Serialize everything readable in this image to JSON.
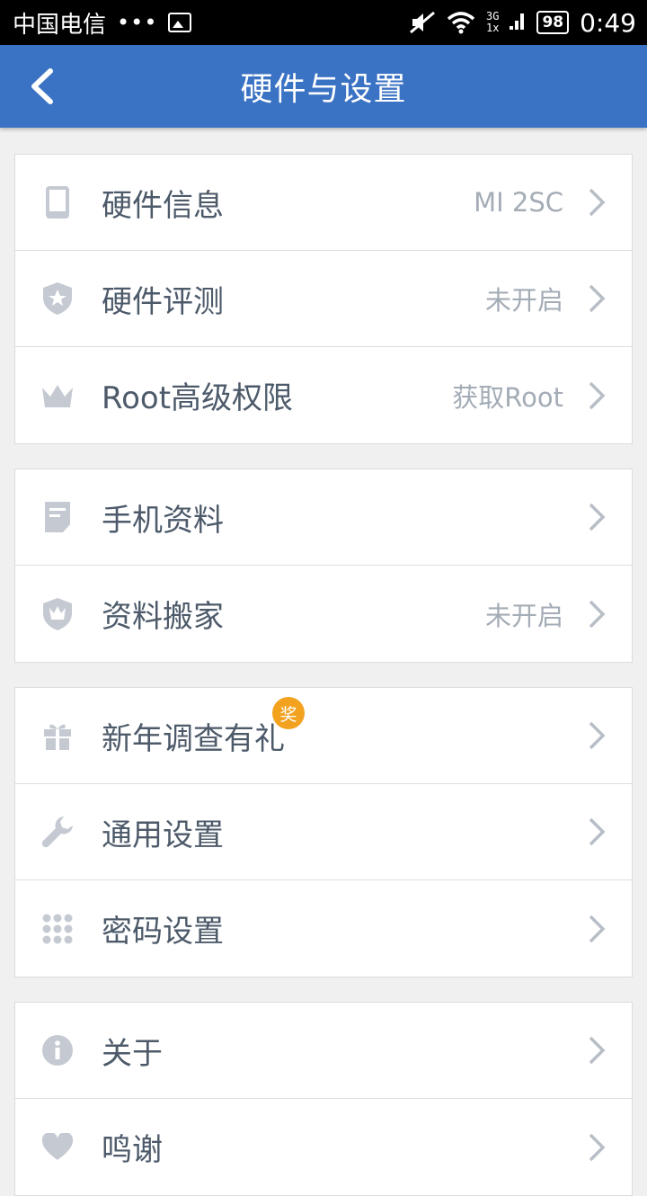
{
  "status_bar": {
    "carrier": "中国电信",
    "dots": "•••",
    "network_top": "3G",
    "network_bottom": "1x",
    "battery": "98",
    "time": "0:49"
  },
  "header": {
    "title": "硬件与设置"
  },
  "groups": [
    {
      "items": [
        {
          "icon": "phone-icon",
          "label": "硬件信息",
          "value": "MI 2SC"
        },
        {
          "icon": "shield-star-icon",
          "label": "硬件评测",
          "value": "未开启"
        },
        {
          "icon": "crown-icon",
          "label": "Root高级权限",
          "value": "获取Root"
        }
      ]
    },
    {
      "items": [
        {
          "icon": "document-icon",
          "label": "手机资料",
          "value": ""
        },
        {
          "icon": "shield-crown-icon",
          "label": "资料搬家",
          "value": "未开启"
        }
      ]
    },
    {
      "items": [
        {
          "icon": "gift-icon",
          "label": "新年调查有礼",
          "value": "",
          "badge": "奖"
        },
        {
          "icon": "wrench-icon",
          "label": "通用设置",
          "value": ""
        },
        {
          "icon": "grid-dots-icon",
          "label": "密码设置",
          "value": ""
        }
      ]
    },
    {
      "items": [
        {
          "icon": "info-icon",
          "label": "关于",
          "value": ""
        },
        {
          "icon": "heart-icon",
          "label": "鸣谢",
          "value": ""
        }
      ]
    }
  ],
  "colors": {
    "header_bg": "#3a72c4",
    "icon_gray": "#c5cad2",
    "badge": "#f3a220",
    "page_bg": "#f0f0f0"
  }
}
